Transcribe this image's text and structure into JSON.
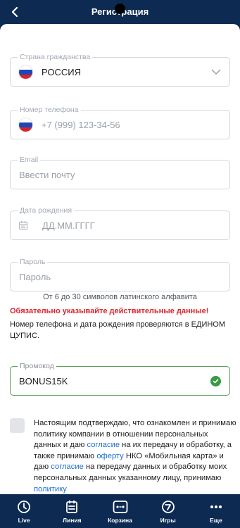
{
  "header": {
    "title": "Регистрация"
  },
  "form": {
    "country": {
      "label": "Страна гражданства",
      "value": "РОССИЯ"
    },
    "phone": {
      "label": "Номер телефона",
      "placeholder": "+7 (999) 123-34-56"
    },
    "email": {
      "label": "Email",
      "placeholder": "Ввести почту"
    },
    "birthdate": {
      "label": "Дата рождения",
      "placeholder": "ДД.ММ.ГГГГ"
    },
    "password": {
      "label": "Пароль",
      "placeholder": "Пароль",
      "hint": "От 6 до 30 символов латинского алфавита"
    },
    "warning": "Обязательно указывайте действительные данные!",
    "note": "Номер телефона и дата рождения проверяются в ЕДИНОМ ЦУПИС.",
    "promo": {
      "label": "Промокод",
      "value": "BONUS15K"
    }
  },
  "agreement": {
    "t1": "Настоящим подтверждаю, что ознакомлен и принимаю политику компании в отношении персональных данных и даю ",
    "l1": "согласие",
    "t2": " на их передачу и обработку, а также принимаю ",
    "l2": "оферту",
    "t3": " НКО «Мобильная карта» и даю ",
    "l3": "согласие",
    "t4": " на передачу данных и обработку моих персональных данных указанному лицу, принимаю ",
    "l4": "политику"
  },
  "tabbar": [
    {
      "label": "Live",
      "icon": "clock-icon"
    },
    {
      "label": "Линия",
      "icon": "list-icon"
    },
    {
      "label": "Корзина",
      "icon": "coupon-icon"
    },
    {
      "label": "Игры",
      "icon": "games-icon"
    },
    {
      "label": "Еще",
      "icon": "more-icon"
    }
  ]
}
